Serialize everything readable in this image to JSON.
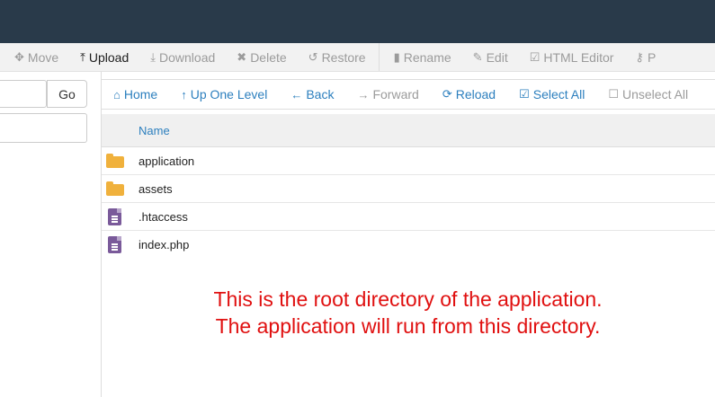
{
  "toolbar": {
    "items": [
      {
        "label": "Move",
        "icon": "move-icon"
      },
      {
        "label": "Upload",
        "icon": "upload-icon"
      },
      {
        "label": "Download",
        "icon": "download-icon"
      },
      {
        "label": "Delete",
        "icon": "delete-icon"
      },
      {
        "label": "Restore",
        "icon": "restore-icon"
      },
      {
        "label": "Rename",
        "icon": "file-icon"
      },
      {
        "label": "Edit",
        "icon": "pencil-icon"
      },
      {
        "label": "HTML Editor",
        "icon": "html-editor-icon"
      },
      {
        "label": "P",
        "icon": "key-icon"
      }
    ]
  },
  "left": {
    "path_value": "",
    "go_label": "Go"
  },
  "nav": {
    "home": "Home",
    "up_one_level": "Up One Level",
    "back": "Back",
    "forward": "Forward",
    "reload": "Reload",
    "select_all": "Select All",
    "unselect_all": "Unselect All"
  },
  "table": {
    "header_name": "Name",
    "rows": [
      {
        "name": "application",
        "type": "folder"
      },
      {
        "name": "assets",
        "type": "folder"
      },
      {
        "name": ".htaccess",
        "type": "file"
      },
      {
        "name": "index.php",
        "type": "file"
      }
    ]
  },
  "annotation": {
    "line1": "This is the root directory of the application.",
    "line2": "The application will run from this directory."
  },
  "colors": {
    "topbar": "#293a4a",
    "link": "#2c7fbe",
    "folder": "#f0b13c",
    "file": "#7a5a9a",
    "annotation": "#e01010"
  }
}
